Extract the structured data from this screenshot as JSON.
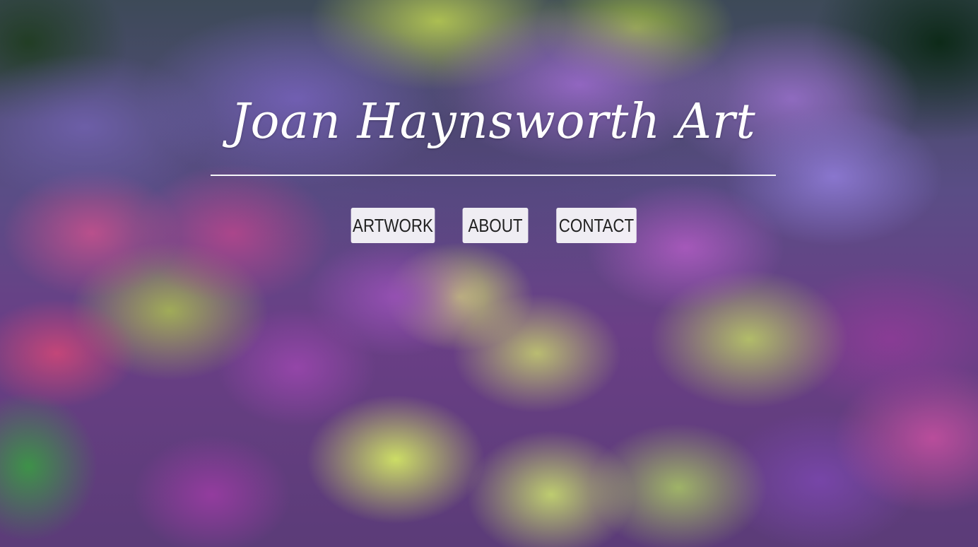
{
  "site": {
    "title": "Joan Haynsworth Art"
  },
  "nav": {
    "items": [
      {
        "label": "ARTWORK"
      },
      {
        "label": "ABOUT"
      },
      {
        "label": "CONTACT"
      }
    ]
  },
  "background": {
    "subject": "hydrangea-flowers-photo",
    "colors": {
      "purple": "#7a4fa0",
      "magenta": "#b8508e",
      "lime": "#c8d870",
      "green": "#3f7a3c"
    }
  }
}
